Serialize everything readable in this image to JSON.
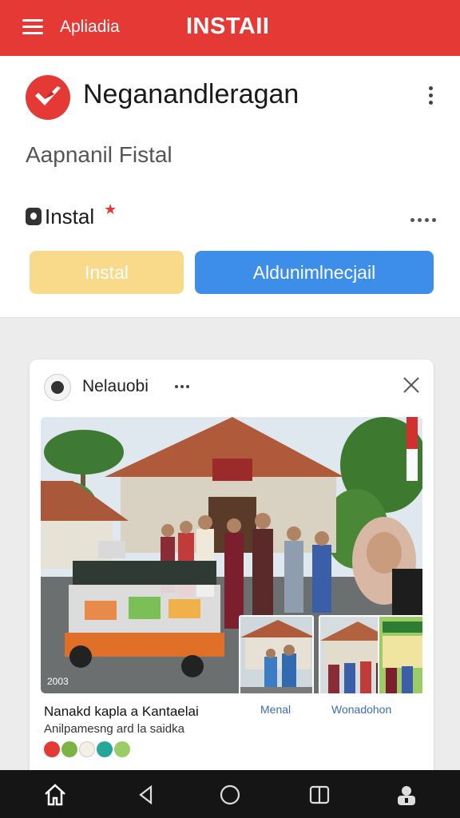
{
  "topbar": {
    "app_label": "Apliadia",
    "title": "INSTAII"
  },
  "app_card": {
    "name": "Neganandleragan",
    "subtitle": "Aapnanil Fistal",
    "install_label": "Instal",
    "install_button": "Instal",
    "primary_button": "Aldunimlnecjail"
  },
  "post": {
    "author": "Nelauobi",
    "photo_year": "2003",
    "caption_title": "Nanakd kapla a Kantaelai",
    "caption_sub": "Anilpamesng ard la saidka",
    "thumbnails": [
      {
        "label": "Menal"
      },
      {
        "label": "Wonadohon"
      }
    ]
  },
  "colors": {
    "brand_red": "#e53935",
    "install_yellow": "#f9d98a",
    "primary_blue": "#3d8ee8",
    "link_blue": "#3b6db0",
    "navbar": "#151515"
  },
  "icons": {
    "menu": "hamburger-icon",
    "more": "more-vert-icon",
    "close": "close-icon",
    "nav": [
      "home-icon",
      "back-icon",
      "circle-home-icon",
      "recents-icon",
      "account-lock-icon"
    ]
  }
}
